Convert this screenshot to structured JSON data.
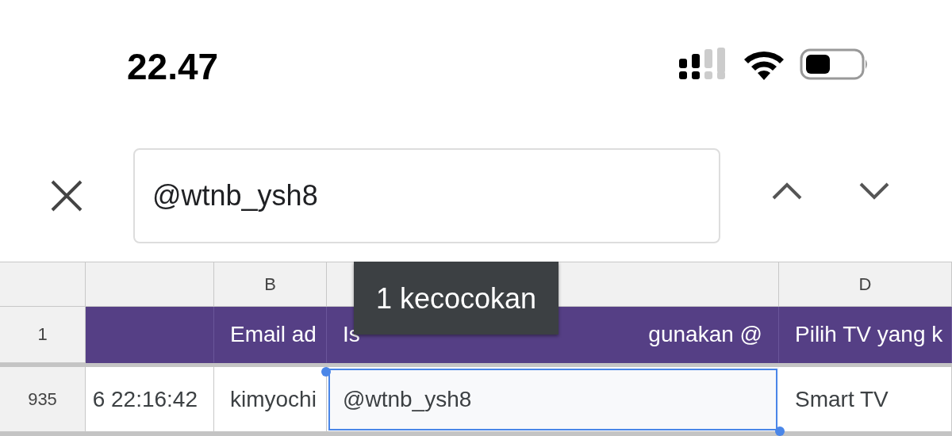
{
  "status_bar": {
    "time": "22.47"
  },
  "find_bar": {
    "query": "@wtnb_ysh8",
    "match_count": "1 kecocokan"
  },
  "sheet": {
    "columns": [
      "",
      "B",
      "",
      "D"
    ],
    "rows": [
      {
        "number": "1",
        "kind": "header",
        "cells": [
          {
            "text": "",
            "selected": false
          },
          {
            "text": "Email ad",
            "selected": false
          },
          {
            "text": "Is",
            "text_end": "gunakan @",
            "selected": false
          },
          {
            "text": "Pilih TV yang k",
            "selected": false
          }
        ]
      },
      {
        "number": "935",
        "kind": "data",
        "cells": [
          {
            "text": "6 22:16:42",
            "selected": false
          },
          {
            "text": "kimyochi",
            "selected": false
          },
          {
            "text": "@wtnb_ysh8",
            "selected": true
          },
          {
            "text": "Smart TV",
            "selected": false
          }
        ]
      }
    ]
  }
}
